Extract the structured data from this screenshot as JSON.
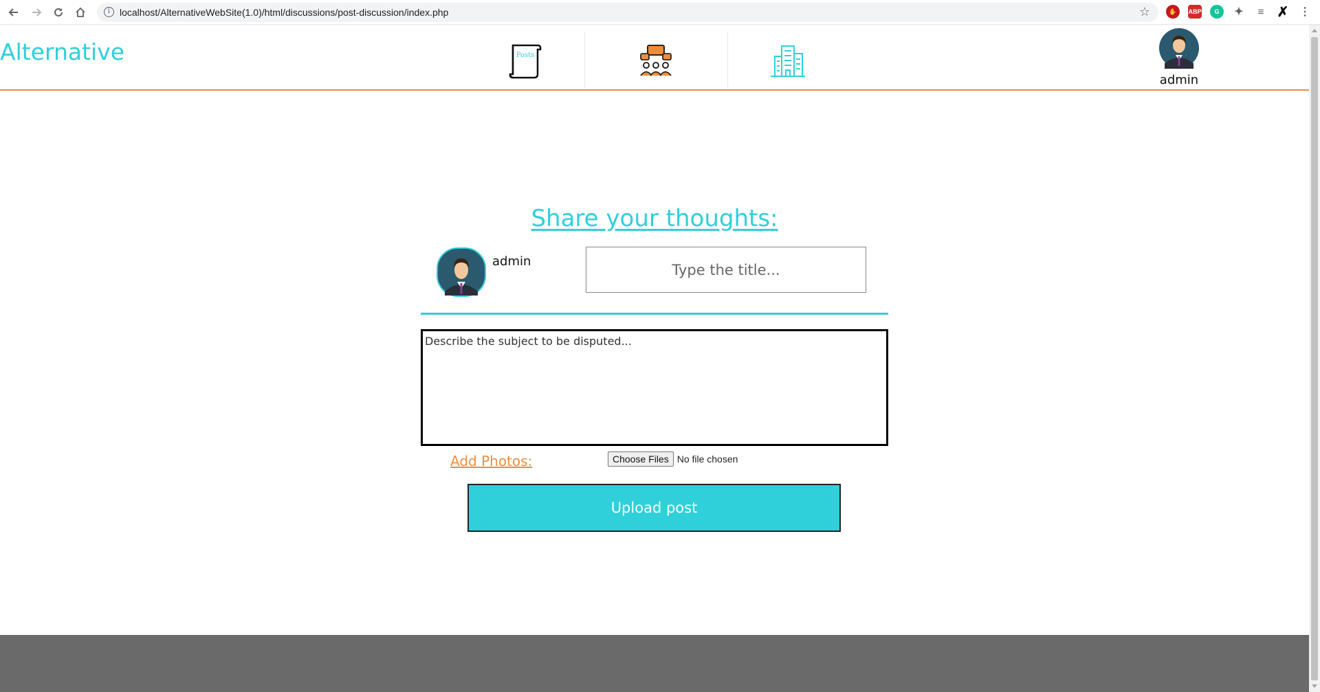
{
  "browser": {
    "url": "localhost/AlternativeWebSite(1.0)/html/discussions/post-discussion/index.php",
    "extensions": [
      "adblock-icon",
      "abp-icon",
      "grammarly-icon",
      "puzzle-icon",
      "playlist-icon",
      "x-icon"
    ],
    "ext_labels": {
      "abp": "ABP",
      "grammarly": "G"
    }
  },
  "header": {
    "logo": "Alternative",
    "nav": [
      {
        "name": "Posts",
        "icon": "posts-scroll-icon"
      },
      {
        "name": "",
        "icon": "discussion-group-icon"
      },
      {
        "name": "",
        "icon": "buildings-icon"
      }
    ],
    "user": "admin"
  },
  "form": {
    "heading": "Share your thoughts:",
    "author": "admin",
    "title_placeholder": "Type the title...",
    "description_placeholder": "Describe the subject to be disputed...",
    "add_photos": "Add Photos:",
    "choose_files": "Choose Files",
    "no_file": "No file chosen",
    "submit": "Upload post"
  },
  "colors": {
    "accent": "#2fd0da",
    "orange": "#ef8c3c",
    "footer": "#6a6a6a"
  }
}
